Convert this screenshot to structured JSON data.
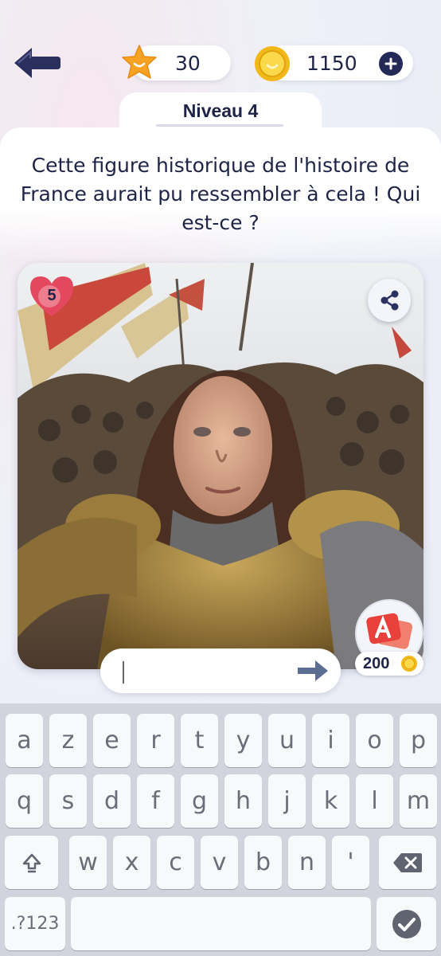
{
  "header": {
    "stars": "30",
    "coins": "1150",
    "level_label": "Niveau 4"
  },
  "question": {
    "text": "Cette figure historique de l'histoire de France aurait pu ressembler à cela ! Qui est-ce ?"
  },
  "image": {
    "lives": "5"
  },
  "hint": {
    "cost": "200"
  },
  "answer": {
    "value": "",
    "placeholder": ""
  },
  "keyboard": {
    "row1": [
      "a",
      "z",
      "e",
      "r",
      "t",
      "y",
      "u",
      "i",
      "o",
      "p"
    ],
    "row2": [
      "q",
      "s",
      "d",
      "f",
      "g",
      "h",
      "j",
      "k",
      "l",
      "m"
    ],
    "row3": [
      "w",
      "x",
      "c",
      "v",
      "b",
      "n",
      "'"
    ],
    "mode_key": ".?123"
  },
  "colors": {
    "navy": "#1e2447",
    "gold": "#f5c21b",
    "heart": "#e4485e",
    "hint_red": "#e8403a"
  },
  "icons": [
    "back-arrow-icon",
    "star-icon",
    "coin-icon",
    "plus-icon",
    "heart-icon",
    "share-icon",
    "hint-icon",
    "submit-arrow-icon",
    "shift-icon",
    "backspace-icon",
    "checkmark-icon"
  ]
}
